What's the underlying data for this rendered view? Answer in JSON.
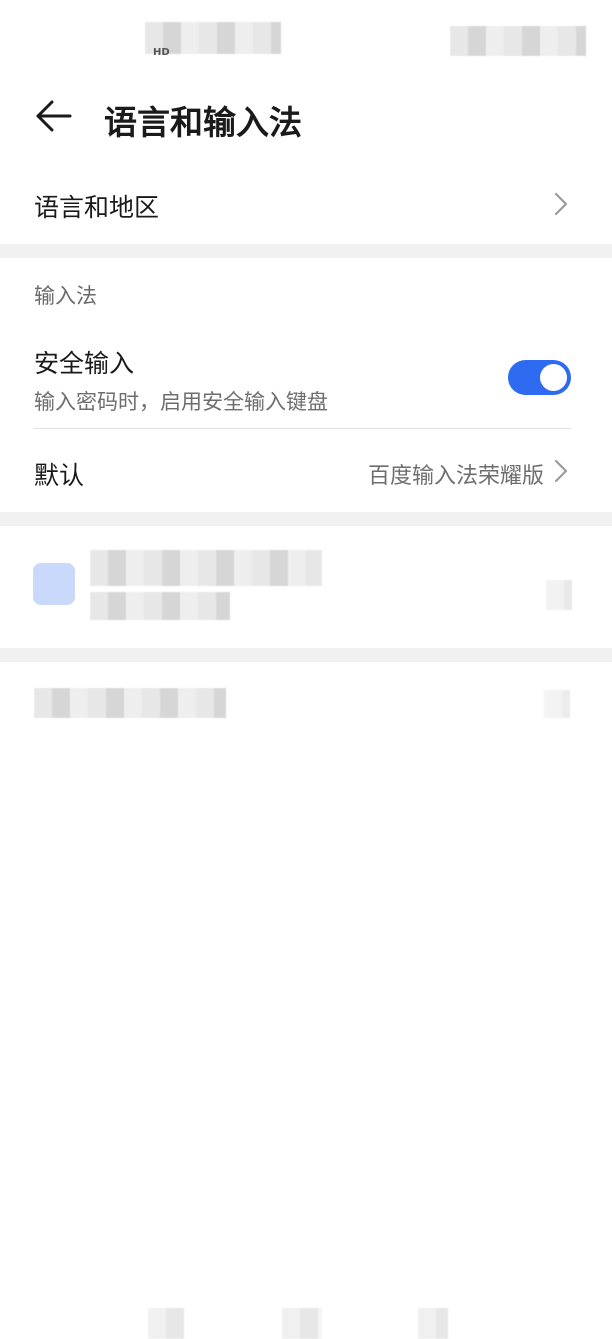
{
  "status_bar": {
    "hd_label": "HD"
  },
  "header": {
    "title": "语言和输入法"
  },
  "rows": {
    "language_region": {
      "label": "语言和地区"
    },
    "section_input_methods": {
      "label": "输入法"
    },
    "secure_input": {
      "label": "安全输入",
      "description": "输入密码时，启用安全输入键盘",
      "enabled": true
    },
    "default": {
      "label": "默认",
      "value": "百度输入法荣耀版"
    }
  },
  "colors": {
    "toggle_on": "#2f6bf0",
    "section_divider": "#f1f1f1",
    "secondary_text": "#6e6e6e"
  },
  "icons": [
    "back-arrow-icon",
    "chevron-right-icon"
  ]
}
